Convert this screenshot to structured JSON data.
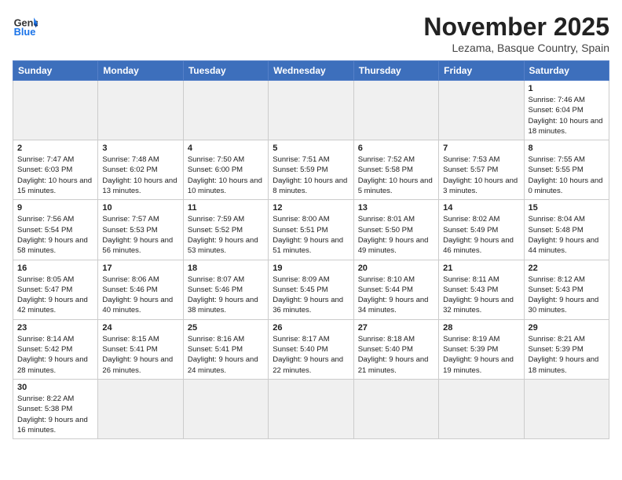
{
  "header": {
    "logo_general": "General",
    "logo_blue": "Blue",
    "month_title": "November 2025",
    "location": "Lezama, Basque Country, Spain"
  },
  "weekdays": [
    "Sunday",
    "Monday",
    "Tuesday",
    "Wednesday",
    "Thursday",
    "Friday",
    "Saturday"
  ],
  "weeks": [
    [
      {
        "day": "",
        "info": ""
      },
      {
        "day": "",
        "info": ""
      },
      {
        "day": "",
        "info": ""
      },
      {
        "day": "",
        "info": ""
      },
      {
        "day": "",
        "info": ""
      },
      {
        "day": "",
        "info": ""
      },
      {
        "day": "1",
        "info": "Sunrise: 7:46 AM\nSunset: 6:04 PM\nDaylight: 10 hours and 18 minutes."
      }
    ],
    [
      {
        "day": "2",
        "info": "Sunrise: 7:47 AM\nSunset: 6:03 PM\nDaylight: 10 hours and 15 minutes."
      },
      {
        "day": "3",
        "info": "Sunrise: 7:48 AM\nSunset: 6:02 PM\nDaylight: 10 hours and 13 minutes."
      },
      {
        "day": "4",
        "info": "Sunrise: 7:50 AM\nSunset: 6:00 PM\nDaylight: 10 hours and 10 minutes."
      },
      {
        "day": "5",
        "info": "Sunrise: 7:51 AM\nSunset: 5:59 PM\nDaylight: 10 hours and 8 minutes."
      },
      {
        "day": "6",
        "info": "Sunrise: 7:52 AM\nSunset: 5:58 PM\nDaylight: 10 hours and 5 minutes."
      },
      {
        "day": "7",
        "info": "Sunrise: 7:53 AM\nSunset: 5:57 PM\nDaylight: 10 hours and 3 minutes."
      },
      {
        "day": "8",
        "info": "Sunrise: 7:55 AM\nSunset: 5:55 PM\nDaylight: 10 hours and 0 minutes."
      }
    ],
    [
      {
        "day": "9",
        "info": "Sunrise: 7:56 AM\nSunset: 5:54 PM\nDaylight: 9 hours and 58 minutes."
      },
      {
        "day": "10",
        "info": "Sunrise: 7:57 AM\nSunset: 5:53 PM\nDaylight: 9 hours and 56 minutes."
      },
      {
        "day": "11",
        "info": "Sunrise: 7:59 AM\nSunset: 5:52 PM\nDaylight: 9 hours and 53 minutes."
      },
      {
        "day": "12",
        "info": "Sunrise: 8:00 AM\nSunset: 5:51 PM\nDaylight: 9 hours and 51 minutes."
      },
      {
        "day": "13",
        "info": "Sunrise: 8:01 AM\nSunset: 5:50 PM\nDaylight: 9 hours and 49 minutes."
      },
      {
        "day": "14",
        "info": "Sunrise: 8:02 AM\nSunset: 5:49 PM\nDaylight: 9 hours and 46 minutes."
      },
      {
        "day": "15",
        "info": "Sunrise: 8:04 AM\nSunset: 5:48 PM\nDaylight: 9 hours and 44 minutes."
      }
    ],
    [
      {
        "day": "16",
        "info": "Sunrise: 8:05 AM\nSunset: 5:47 PM\nDaylight: 9 hours and 42 minutes."
      },
      {
        "day": "17",
        "info": "Sunrise: 8:06 AM\nSunset: 5:46 PM\nDaylight: 9 hours and 40 minutes."
      },
      {
        "day": "18",
        "info": "Sunrise: 8:07 AM\nSunset: 5:46 PM\nDaylight: 9 hours and 38 minutes."
      },
      {
        "day": "19",
        "info": "Sunrise: 8:09 AM\nSunset: 5:45 PM\nDaylight: 9 hours and 36 minutes."
      },
      {
        "day": "20",
        "info": "Sunrise: 8:10 AM\nSunset: 5:44 PM\nDaylight: 9 hours and 34 minutes."
      },
      {
        "day": "21",
        "info": "Sunrise: 8:11 AM\nSunset: 5:43 PM\nDaylight: 9 hours and 32 minutes."
      },
      {
        "day": "22",
        "info": "Sunrise: 8:12 AM\nSunset: 5:43 PM\nDaylight: 9 hours and 30 minutes."
      }
    ],
    [
      {
        "day": "23",
        "info": "Sunrise: 8:14 AM\nSunset: 5:42 PM\nDaylight: 9 hours and 28 minutes."
      },
      {
        "day": "24",
        "info": "Sunrise: 8:15 AM\nSunset: 5:41 PM\nDaylight: 9 hours and 26 minutes."
      },
      {
        "day": "25",
        "info": "Sunrise: 8:16 AM\nSunset: 5:41 PM\nDaylight: 9 hours and 24 minutes."
      },
      {
        "day": "26",
        "info": "Sunrise: 8:17 AM\nSunset: 5:40 PM\nDaylight: 9 hours and 22 minutes."
      },
      {
        "day": "27",
        "info": "Sunrise: 8:18 AM\nSunset: 5:40 PM\nDaylight: 9 hours and 21 minutes."
      },
      {
        "day": "28",
        "info": "Sunrise: 8:19 AM\nSunset: 5:39 PM\nDaylight: 9 hours and 19 minutes."
      },
      {
        "day": "29",
        "info": "Sunrise: 8:21 AM\nSunset: 5:39 PM\nDaylight: 9 hours and 18 minutes."
      }
    ],
    [
      {
        "day": "30",
        "info": "Sunrise: 8:22 AM\nSunset: 5:38 PM\nDaylight: 9 hours and 16 minutes."
      },
      {
        "day": "",
        "info": ""
      },
      {
        "day": "",
        "info": ""
      },
      {
        "day": "",
        "info": ""
      },
      {
        "day": "",
        "info": ""
      },
      {
        "day": "",
        "info": ""
      },
      {
        "day": "",
        "info": ""
      }
    ]
  ]
}
